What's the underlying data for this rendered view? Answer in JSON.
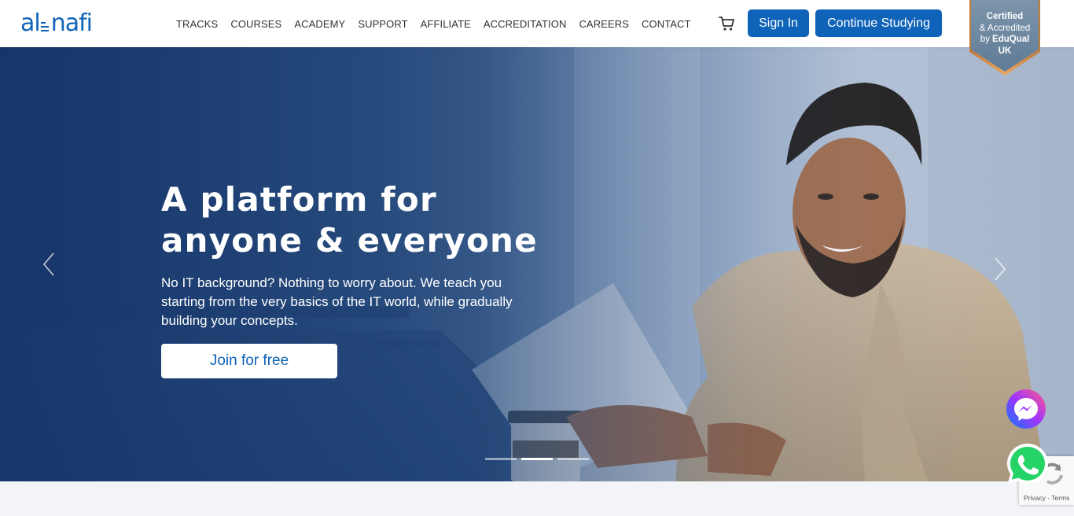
{
  "brand": {
    "logo_left": "al",
    "logo_right": "nafi",
    "primary_color": "#0f63b8"
  },
  "nav": {
    "items": [
      {
        "label": "TRACKS"
      },
      {
        "label": "COURSES"
      },
      {
        "label": "ACADEMY"
      },
      {
        "label": "SUPPORT"
      },
      {
        "label": "AFFILIATE"
      },
      {
        "label": "ACCREDITATION"
      },
      {
        "label": "CAREERS"
      },
      {
        "label": "CONTACT"
      }
    ]
  },
  "header": {
    "cart_icon": "cart-icon",
    "sign_in_label": "Sign In",
    "continue_label": "Continue Studying"
  },
  "badge": {
    "line1": "Certified",
    "line2": "& Accredited",
    "line3_prefix": "by ",
    "line3_brand": "EduQual",
    "line4": "UK",
    "color": "#6d88a0"
  },
  "hero": {
    "title_line1": "A platform for",
    "title_line2": "anyone & everyone",
    "description": "No IT background? Nothing to worry about. We teach you starting from the very basics of the IT world, while gradually building your concepts.",
    "cta_label": "Join for free",
    "active_slide": 2,
    "slide_count": 3
  },
  "widgets": {
    "messenger_icon": "messenger-icon",
    "whatsapp_icon": "whatsapp-icon",
    "recaptcha_privacy": "Privacy",
    "recaptcha_separator": " - ",
    "recaptcha_terms": "Terms"
  }
}
